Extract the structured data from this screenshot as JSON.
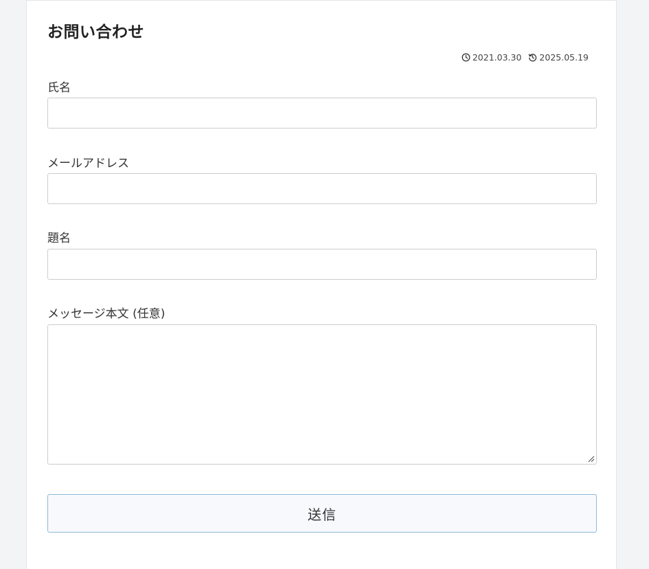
{
  "page": {
    "title": "お問い合わせ",
    "published_date": "2021.03.30",
    "updated_date": "2025.05.19"
  },
  "form": {
    "name_label": "氏名",
    "name_value": "",
    "email_label": "メールアドレス",
    "email_value": "",
    "subject_label": "題名",
    "subject_value": "",
    "message_label": "メッセージ本文 (任意)",
    "message_value": "",
    "submit_label": "送信"
  },
  "icons": {
    "published": "clock-icon",
    "updated": "history-icon"
  },
  "colors": {
    "background": "#f3f4f6",
    "card": "#ffffff",
    "input_border": "#cccccc",
    "button_border": "#8fb9d6",
    "button_bg": "#f7f9fc"
  }
}
